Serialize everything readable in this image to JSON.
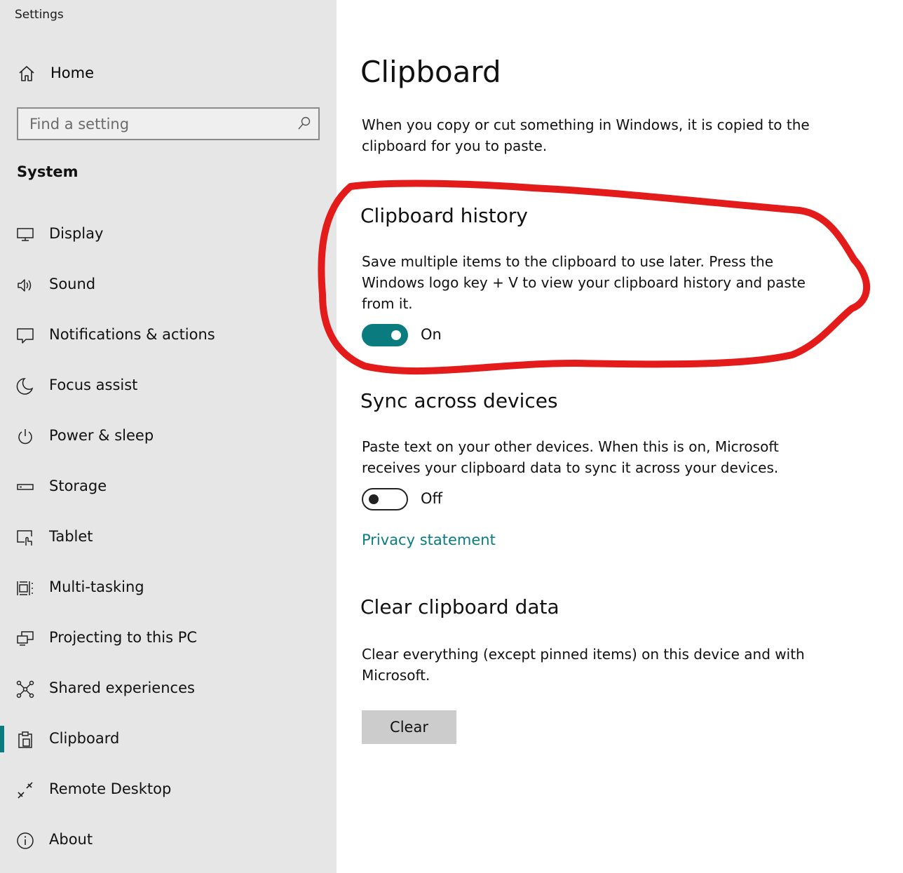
{
  "window": {
    "title": "Settings"
  },
  "sidebar": {
    "home_label": "Home",
    "search": {
      "placeholder": "Find a setting",
      "value": ""
    },
    "section_label": "System",
    "items": [
      {
        "label": "Display",
        "icon": "monitor-icon"
      },
      {
        "label": "Sound",
        "icon": "speaker-icon"
      },
      {
        "label": "Notifications & actions",
        "icon": "notification-icon"
      },
      {
        "label": "Focus assist",
        "icon": "moon-icon"
      },
      {
        "label": "Power & sleep",
        "icon": "power-icon"
      },
      {
        "label": "Storage",
        "icon": "storage-icon"
      },
      {
        "label": "Tablet",
        "icon": "tablet-icon"
      },
      {
        "label": "Multi-tasking",
        "icon": "multitasking-icon"
      },
      {
        "label": "Projecting to this PC",
        "icon": "projecting-icon"
      },
      {
        "label": "Shared experiences",
        "icon": "shared-experiences-icon"
      },
      {
        "label": "Clipboard",
        "icon": "clipboard-icon",
        "selected": true
      },
      {
        "label": "Remote Desktop",
        "icon": "remote-desktop-icon"
      },
      {
        "label": "About",
        "icon": "info-icon"
      }
    ]
  },
  "main": {
    "title": "Clipboard",
    "intro": "When you copy or cut something in Windows, it is copied to the clipboard for you to paste.",
    "history": {
      "heading": "Clipboard history",
      "description": "Save multiple items to the clipboard to use later. Press the Windows logo key + V to view your clipboard history and paste from it.",
      "toggle_state": "On",
      "enabled": true
    },
    "sync": {
      "heading": "Sync across devices",
      "description": "Paste text on your other devices. When this is on, Microsoft receives your clipboard data to sync it across your devices.",
      "toggle_state": "Off",
      "enabled": false,
      "privacy_link": "Privacy statement"
    },
    "clear": {
      "heading": "Clear clipboard data",
      "description": "Clear everything (except pinned items) on this device and with Microsoft.",
      "button_label": "Clear"
    }
  },
  "colors": {
    "accent": "#0a7c80",
    "sidebar_bg": "#e6e6e6",
    "annotation": "#e31b1b"
  }
}
